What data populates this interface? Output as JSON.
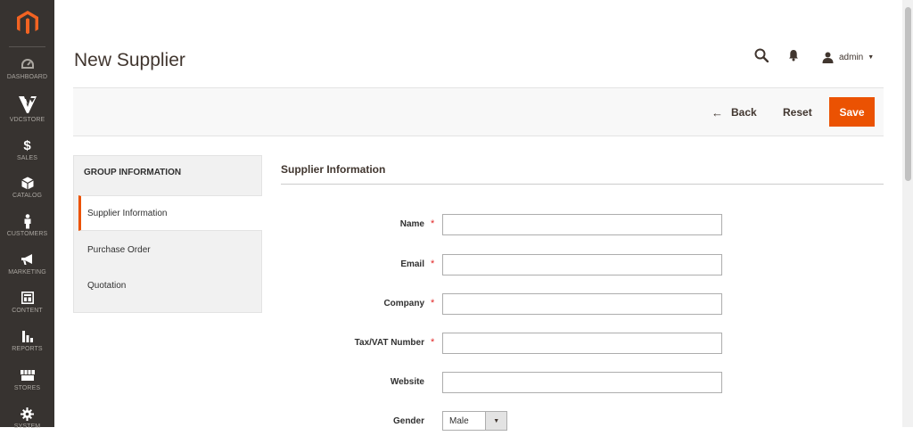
{
  "sidebar": {
    "items": [
      {
        "label": "DASHBOARD",
        "icon": "dashboard-icon"
      },
      {
        "label": "VDCSTORE",
        "icon": "vdcstore-icon"
      },
      {
        "label": "SALES",
        "icon": "dollar-icon"
      },
      {
        "label": "CATALOG",
        "icon": "cube-icon"
      },
      {
        "label": "CUSTOMERS",
        "icon": "person-icon"
      },
      {
        "label": "MARKETING",
        "icon": "megaphone-icon"
      },
      {
        "label": "CONTENT",
        "icon": "content-icon"
      },
      {
        "label": "REPORTS",
        "icon": "bar-chart-icon"
      },
      {
        "label": "STORES",
        "icon": "store-icon"
      },
      {
        "label": "SYSTEM",
        "icon": "gear-icon"
      }
    ]
  },
  "header": {
    "title": "New Supplier",
    "user": "admin"
  },
  "actions": {
    "back": "Back",
    "reset": "Reset",
    "save": "Save"
  },
  "group_nav": {
    "title": "GROUP INFORMATION",
    "items": [
      "Supplier Information",
      "Purchase Order",
      "Quotation"
    ]
  },
  "form": {
    "section_title": "Supplier Information",
    "fields": [
      {
        "label": "Name",
        "required": true,
        "value": ""
      },
      {
        "label": "Email",
        "required": true,
        "value": ""
      },
      {
        "label": "Company",
        "required": true,
        "value": ""
      },
      {
        "label": "Tax/VAT Number",
        "required": true,
        "value": ""
      },
      {
        "label": "Website",
        "required": false,
        "value": ""
      }
    ],
    "gender": {
      "label": "Gender",
      "value": "Male"
    },
    "required_mark": "*"
  },
  "colors": {
    "accent": "#eb5202",
    "sidebar": "#373330"
  }
}
